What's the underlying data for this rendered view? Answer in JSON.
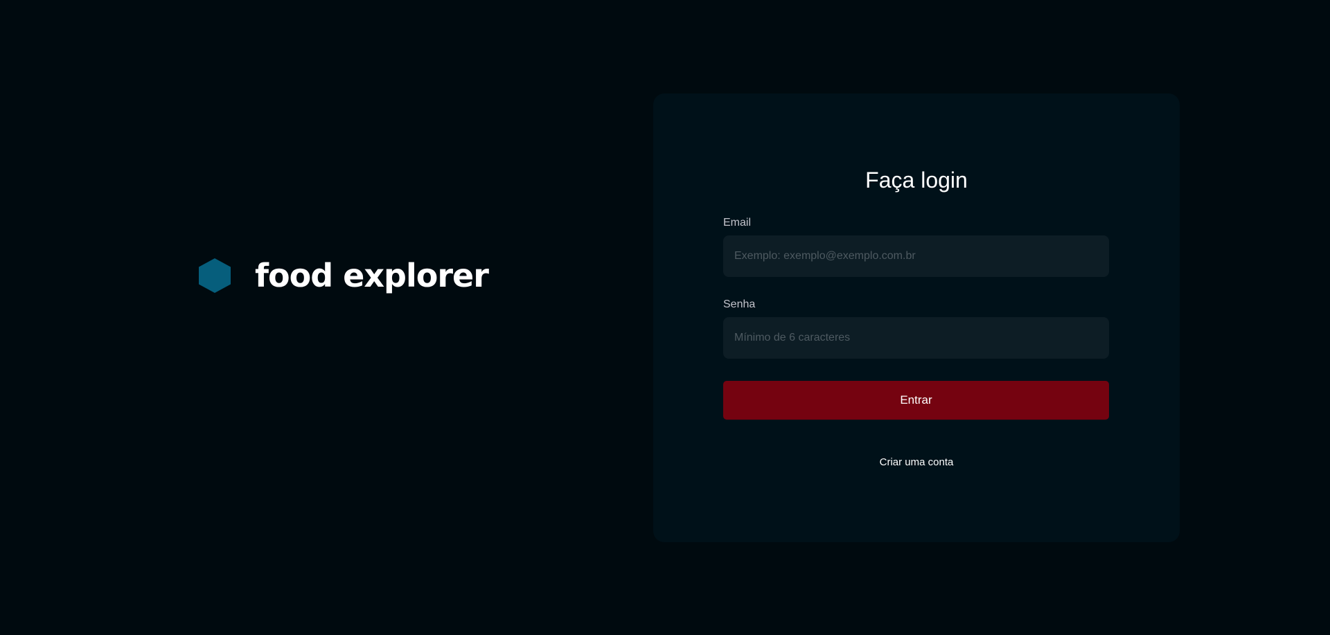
{
  "brand": {
    "name": "food explorer",
    "icon": "hexagon-icon",
    "icon_color": "#065E7C"
  },
  "login": {
    "title": "Faça login",
    "email": {
      "label": "Email",
      "value": "",
      "placeholder": "Exemplo: exemplo@exemplo.com.br"
    },
    "password": {
      "label": "Senha",
      "value": "",
      "placeholder": "Mínimo de 6 caracteres"
    },
    "submit_label": "Entrar",
    "create_account_label": "Criar uma conta"
  },
  "colors": {
    "background": "#000A0F",
    "card": "#001119",
    "input": "#0D1D25",
    "accent": "#750310",
    "text": "#FFFFFF"
  }
}
